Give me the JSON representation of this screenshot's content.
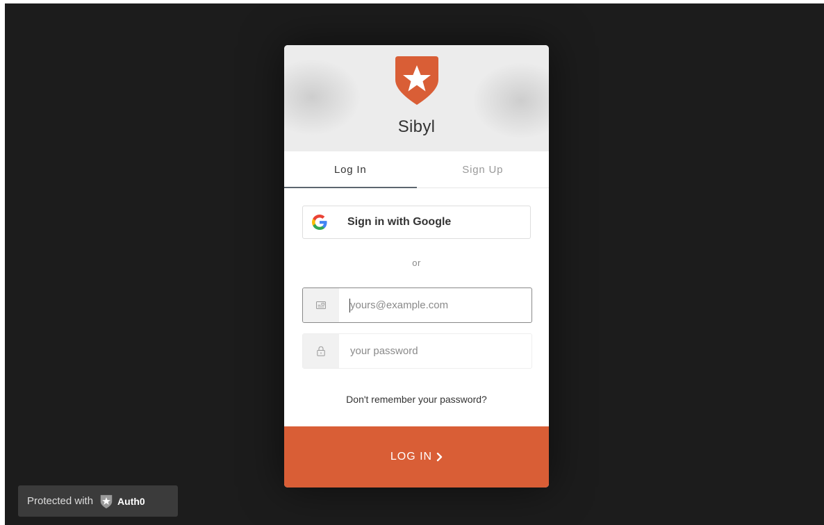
{
  "app": {
    "title": "Sibyl"
  },
  "tabs": [
    {
      "label": "Log In",
      "active": true
    },
    {
      "label": "Sign Up",
      "active": false
    }
  ],
  "social": {
    "google_label": "Sign in with Google",
    "icon": "google-icon"
  },
  "divider_text": "or",
  "fields": {
    "email": {
      "value": "",
      "placeholder": "yours@example.com",
      "icon": "id-card-icon"
    },
    "password": {
      "value": "",
      "placeholder": "your password",
      "icon": "lock-icon"
    }
  },
  "forgot_password": "Don't remember your password?",
  "submit": {
    "label": "LOG IN",
    "icon": "chevron-right-icon"
  },
  "badge": {
    "text": "Protected with",
    "brand": "Auth0",
    "icon": "auth0-icon"
  },
  "colors": {
    "accent": "#d95e36",
    "background": "#1c1c1c",
    "header": "#ececec",
    "badge": "#3b3b3b"
  }
}
